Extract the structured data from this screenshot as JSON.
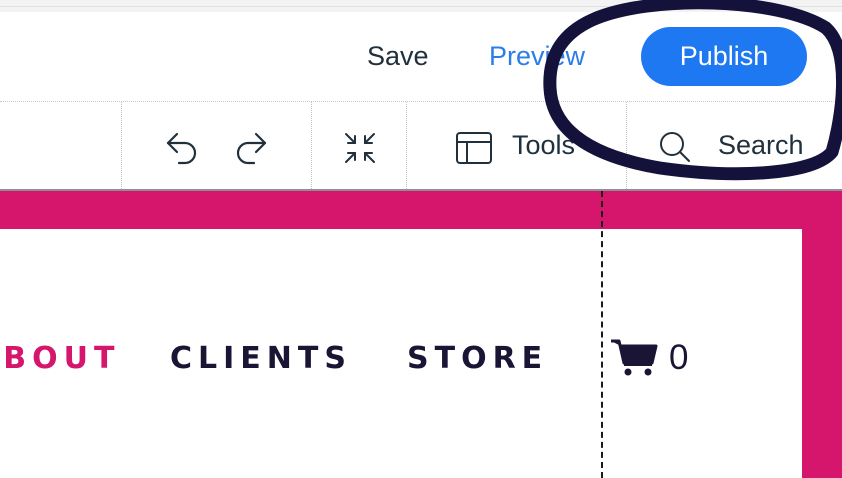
{
  "header": {
    "save_label": "Save",
    "preview_label": "Preview",
    "publish_label": "Publish"
  },
  "toolbar": {
    "tools_label": "Tools",
    "search_label": "Search"
  },
  "site": {
    "nav": [
      "ABOUT",
      "CLIENTS",
      "STORE"
    ],
    "cart_count": "0"
  },
  "colors": {
    "brand_pink": "#d5166c",
    "publish_blue": "#1d78f2",
    "preview_blue": "#2b7de9",
    "nav_dark": "#1a1535",
    "annotation": "#14123a"
  }
}
